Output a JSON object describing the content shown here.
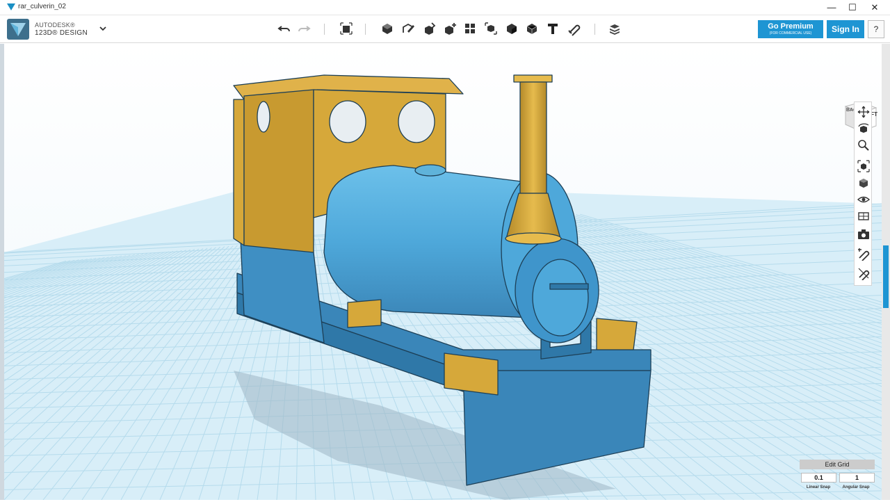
{
  "window": {
    "title": "rar_culverin_02",
    "minimize_glyph": "—",
    "maximize_glyph": "☐",
    "close_glyph": "✕"
  },
  "brand": {
    "line1": "AUTODESK®",
    "line2": "123D® DESIGN"
  },
  "toolbar": {
    "tools": [
      "undo-icon",
      "redo-icon",
      "transform-icon",
      "primitives-icon",
      "sketch-icon",
      "construct-icon",
      "modify-icon",
      "pattern-icon",
      "grouping-icon",
      "combine-icon",
      "measure-icon",
      "text-icon",
      "snap-icon",
      "material-icon"
    ]
  },
  "actions": {
    "premium_label": "Go Premium",
    "premium_sub": "(FOR COMMERCIAL USE)",
    "signin_label": "Sign In",
    "help_label": "?"
  },
  "viewcube": {
    "back_label": "BACK",
    "left_label": "LEFT"
  },
  "navbar": {
    "items": [
      "pan-icon",
      "orbit-icon",
      "zoom-icon",
      "fit-icon",
      "view-cube-icon",
      "visibility-icon",
      "material-view-icon",
      "camera-icon",
      "snap-view-icon",
      "settings-view-icon"
    ]
  },
  "edit_grid": {
    "title": "Edit Grid",
    "linear_value": "0.1",
    "angular_value": "1",
    "linear_label": "Linear Snap",
    "angular_label": "Angular Snap"
  },
  "colors": {
    "accent": "#1e95d3",
    "model_blue": "#4fa9dc",
    "model_gold": "#d6a83a",
    "grid_line": "#b5dbec"
  }
}
